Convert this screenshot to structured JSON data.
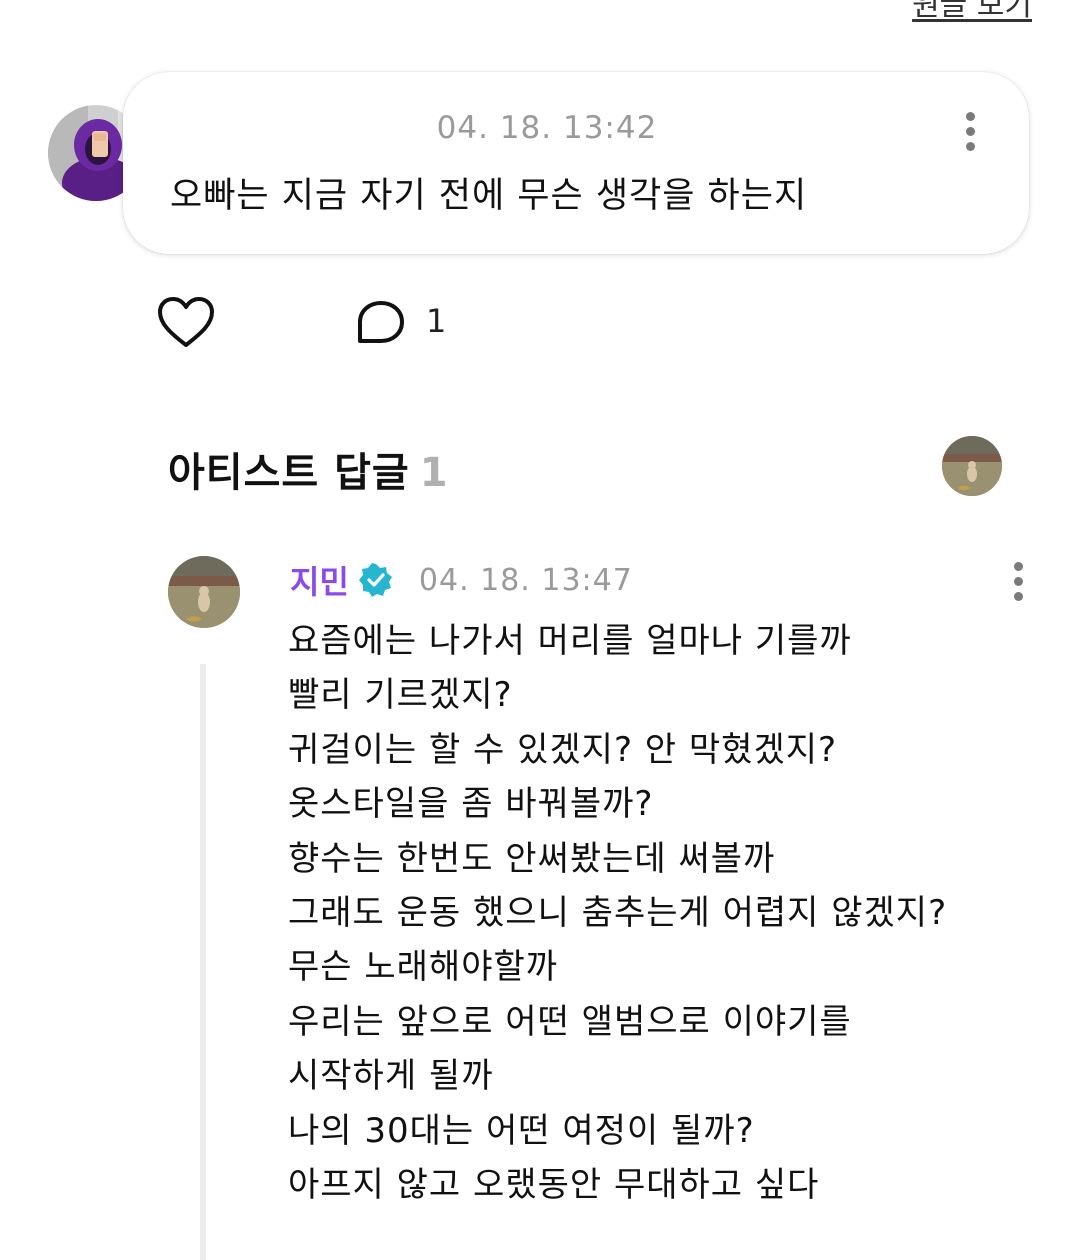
{
  "header": {
    "view_original_label": "원글 보기"
  },
  "post": {
    "timestamp": "04. 18. 13:42",
    "text": "오빠는 지금 자기 전에 무슨 생각을 하는지",
    "avatar_icon": "user-avatar-photo",
    "more_icon": "kebab-menu-icon"
  },
  "actions": {
    "like_icon": "heart-outline-icon",
    "comment_icon": "speech-bubble-icon",
    "comment_count": "1"
  },
  "artist_replies": {
    "title": "아티스트 답글",
    "count": "1"
  },
  "reply": {
    "author": "지민",
    "verified": true,
    "timestamp": "04. 18. 13:47",
    "lines": [
      "요즘에는 나가서 머리를 얼마나 기를까",
      "빨리 기르겠지?",
      "귀걸이는 할 수 있겠지? 안 막혔겠지?",
      "옷스타일을 좀 바꿔볼까?",
      "향수는 한번도 안써봤는데 써볼까",
      "그래도 운동 했으니 춤추는게 어렵지 않겠지?",
      "무슨 노래해야할까",
      "우리는 앞으로 어떤 앨범으로 이야기를",
      "시작하게 될까",
      "나의 30대는 어떤 여정이 될까?",
      "아프지 않고 오랬동안 무대하고 싶다"
    ]
  },
  "colors": {
    "artist_name": "#8b4be8",
    "verified_badge": "#27b6cf",
    "timestamp": "#9a9a9a"
  }
}
